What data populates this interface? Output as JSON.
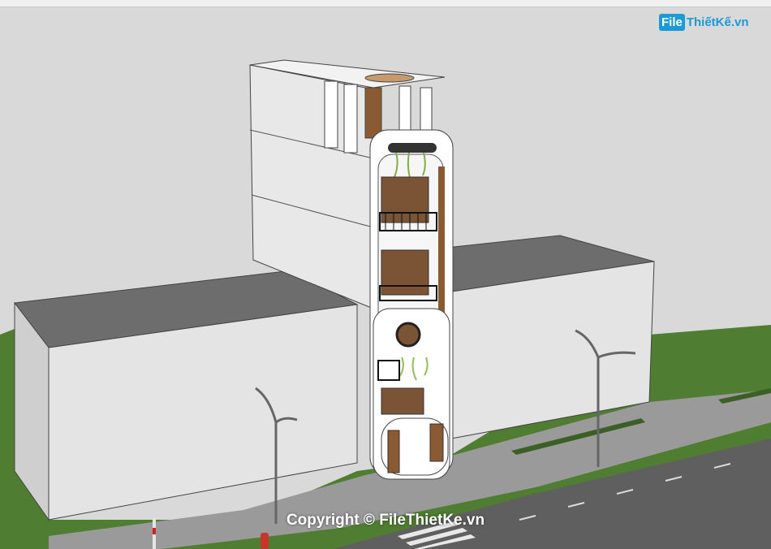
{
  "watermark": {
    "logo_box": "File",
    "logo_rest": "ThiếtKế.vn",
    "copyright": "Copyright © FileThietKe.vn"
  },
  "colors": {
    "sky": "#d9d9d9",
    "grass": "#4f7d31",
    "pavement": "#8e8e8e",
    "road": "#5d5d5d",
    "block_front": "#e2e2e2",
    "block_top": "#6d6d6d",
    "facade": "#ffffff",
    "wood": "#8a5a32",
    "logo": "#1a9ad6"
  },
  "icons": [
    "street-lamp-left",
    "street-lamp-right",
    "fire-hydrant",
    "traffic-pole",
    "hanging-plants"
  ]
}
